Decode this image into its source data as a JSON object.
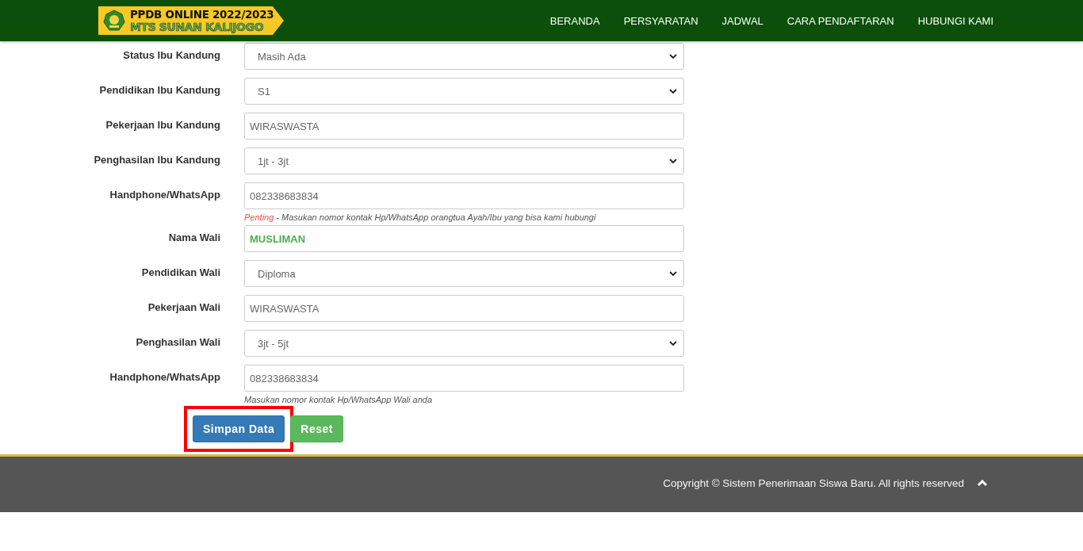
{
  "header": {
    "logo": {
      "line_1": "PPDB ONLINE 2022/2023",
      "line_2": "MTS SUNAN KALIJOGO"
    },
    "nav": [
      "BERANDA",
      "PERSYARATAN",
      "JADWAL",
      "CARA PENDAFTARAN",
      "HUBUNGI KAMI"
    ]
  },
  "form": {
    "rows": [
      {
        "label": "Status Ibu Kandung",
        "kind": "select",
        "value": "Masih Ada"
      },
      {
        "label": "Pendidikan Ibu Kandung",
        "kind": "select",
        "value": "S1"
      },
      {
        "label": "Pekerjaan Ibu Kandung",
        "kind": "input",
        "value": "WIRASWASTA"
      },
      {
        "label": "Penghasilan Ibu Kandung",
        "kind": "select",
        "value": "1jt - 3jt"
      },
      {
        "label": "Handphone/WhatsApp",
        "kind": "input",
        "value": "082338683834",
        "hint_alert": "Penting",
        "hint": " - Masukan nomor kontak Hp/WhatsApp orangtua Ayah/Ibu yang bisa kami hubungi"
      },
      {
        "label": "Nama Wali",
        "kind": "input-strong",
        "value": "MUSLIMAN"
      },
      {
        "label": "Pendidikan Wali",
        "kind": "select",
        "value": "Diploma"
      },
      {
        "label": "Pekerjaan Wali",
        "kind": "input",
        "value": "WIRASWASTA"
      },
      {
        "label": "Penghasilan Wali",
        "kind": "select",
        "value": "3jt - 5jt"
      },
      {
        "label": "Handphone/WhatsApp",
        "kind": "input",
        "value": "082338683834",
        "hint": "Masukan nomor kontak Hp/WhatsApp Wali anda"
      }
    ],
    "buttons": [
      {
        "label": "Simpan Data",
        "kind": "primary",
        "highlighted": true
      },
      {
        "label": "Reset",
        "kind": "success",
        "highlighted": false
      }
    ]
  },
  "footer": {
    "copyright": "Copyright © Sistem Penerimaan Siswa Baru. All rights reserved"
  }
}
